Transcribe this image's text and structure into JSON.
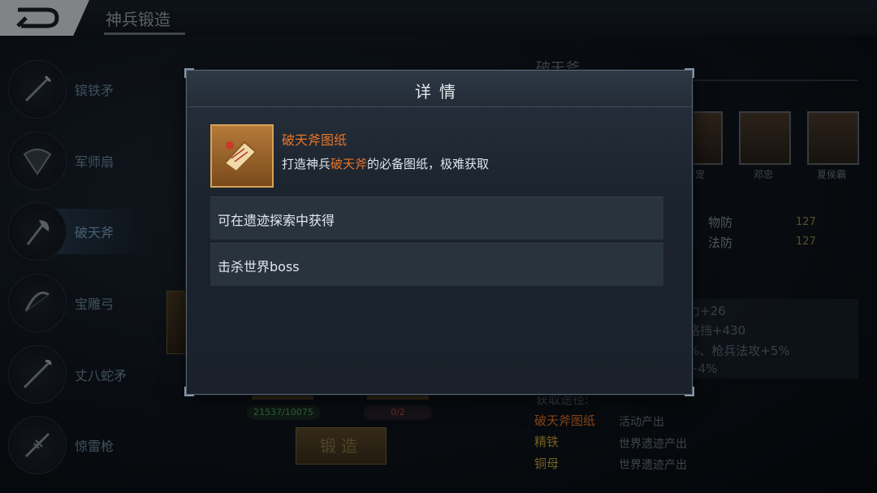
{
  "header": {
    "title": "神兵锻造"
  },
  "weapons": [
    {
      "label": "镔铁矛"
    },
    {
      "label": "军师扇"
    },
    {
      "label": "破天斧"
    },
    {
      "label": "宝雕弓"
    },
    {
      "label": "丈八蛇矛"
    },
    {
      "label": "惊雷枪"
    }
  ],
  "selected_weapon": "破天斧",
  "right_panel": {
    "title": "破天斧",
    "heroes": [
      {
        "name": "蒋宠"
      },
      {
        "name": "邓忠"
      },
      {
        "name": "夏侯霸"
      }
    ],
    "stats": [
      {
        "label": "物防",
        "value": "127"
      },
      {
        "label": "法防",
        "value": "127"
      }
    ],
    "attributes": [
      "力+26",
      "格挡+430",
      "%、枪兵法攻+5%",
      "+4%"
    ],
    "acquire_title": "获取途径:",
    "acquire": [
      {
        "name": "破天斧图纸",
        "source": "活动产出",
        "color": "#e8742a"
      },
      {
        "name": "精铁",
        "source": "世界遗迹产出",
        "color": "#c9a53a"
      },
      {
        "name": "铜母",
        "source": "世界遗迹产出",
        "color": "#c9a53a"
      }
    ]
  },
  "materials": [
    {
      "count": "21537/10075"
    },
    {
      "count": "0/2"
    }
  ],
  "forge_button": "锻造",
  "modal": {
    "title": "详情",
    "item_name": "破天斧图纸",
    "desc_prefix": "打造神兵",
    "desc_highlight": "破天斧",
    "desc_suffix": "的必备图纸，极难获取",
    "sources": [
      "可在遗迹探索中获得",
      "击杀世界boss"
    ]
  },
  "colors": {
    "accent_orange": "#e8742a",
    "modal_bg": "#1b232d"
  },
  "icons": [
    "back-arrow-icon",
    "scroll-icon"
  ]
}
